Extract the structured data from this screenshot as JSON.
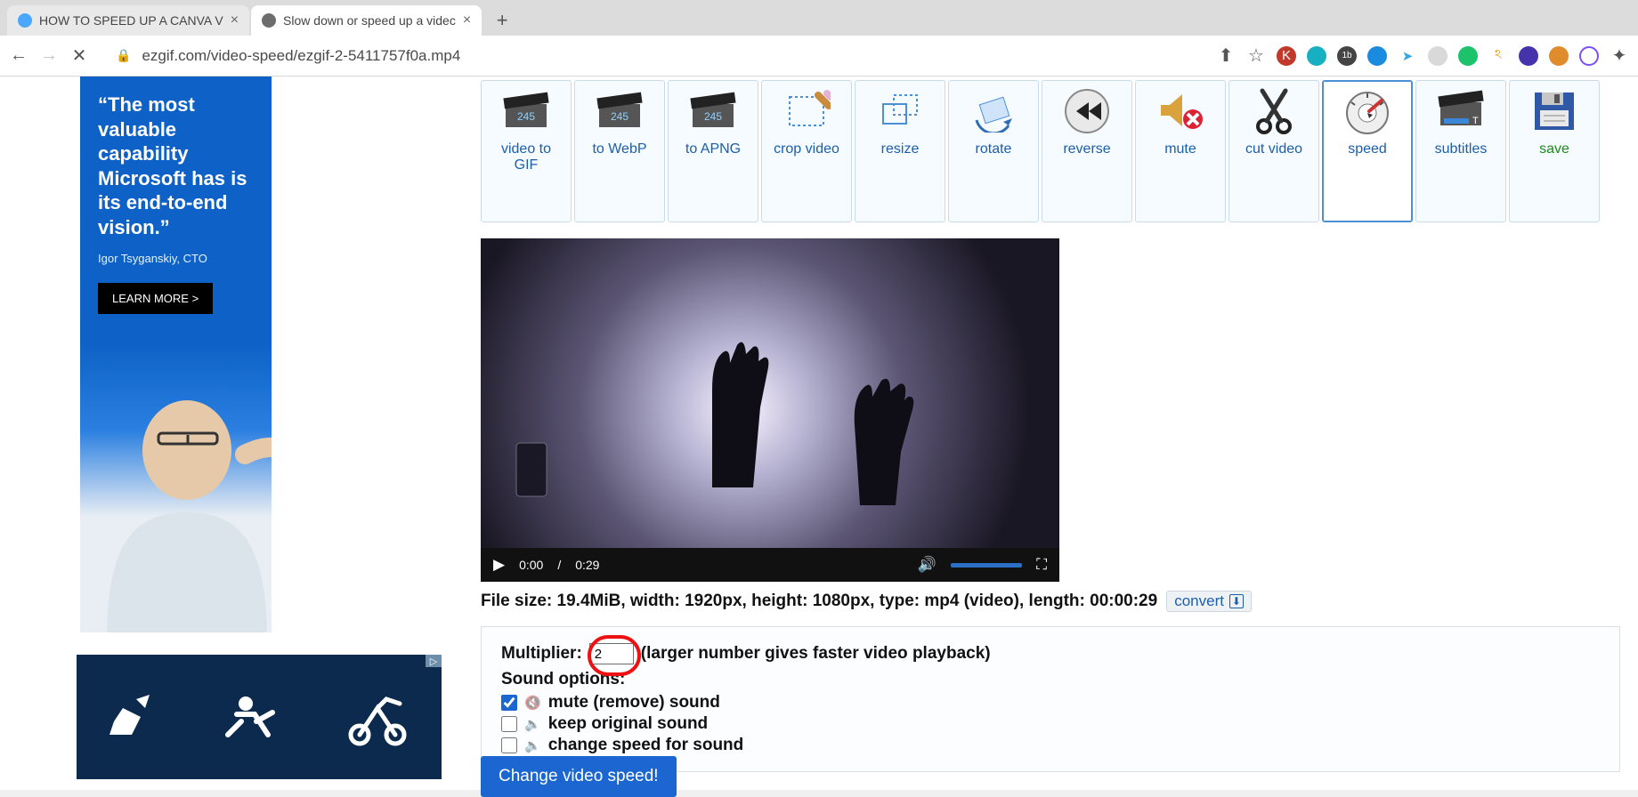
{
  "browser": {
    "tabs": [
      {
        "title": "HOW TO SPEED UP A CANVA V",
        "active": false
      },
      {
        "title": "Slow down or speed up a videc",
        "active": true
      }
    ],
    "url": "ezgif.com/video-speed/ezgif-2-5411757f0a.mp4"
  },
  "ad1": {
    "quote": "“The most valuable capability Microsoft has is its end-to-end vision.”",
    "byline": "Igor Tsyganskiy, CTO",
    "cta": "LEARN MORE >"
  },
  "tools": [
    {
      "label": "video to\nGIF",
      "key": "video-to-gif"
    },
    {
      "label": "to WebP",
      "key": "to-webp"
    },
    {
      "label": "to APNG",
      "key": "to-apng"
    },
    {
      "label": "crop video",
      "key": "crop-video"
    },
    {
      "label": "resize",
      "key": "resize"
    },
    {
      "label": "rotate",
      "key": "rotate"
    },
    {
      "label": "reverse",
      "key": "reverse"
    },
    {
      "label": "mute",
      "key": "mute"
    },
    {
      "label": "cut video",
      "key": "cut-video"
    },
    {
      "label": "speed",
      "key": "speed",
      "active": true
    },
    {
      "label": "subtitles",
      "key": "subtitles"
    },
    {
      "label": "save",
      "key": "save"
    }
  ],
  "video": {
    "current": "0:00",
    "sep": "/",
    "total": "0:29"
  },
  "meta": {
    "text": "File size: 19.4MiB, width: 1920px, height: 1080px, type: mp4 (video), length: 00:00:29",
    "convert": "convert"
  },
  "form": {
    "multiplier_label": "Multiplier:",
    "multiplier_value": "2",
    "multiplier_hint": "(larger number gives faster video playback)",
    "sound_header": "Sound options:",
    "options": {
      "mute": "mute (remove) sound",
      "keep": "keep original sound",
      "change": "change speed for sound"
    },
    "submit": "Change video speed!"
  }
}
